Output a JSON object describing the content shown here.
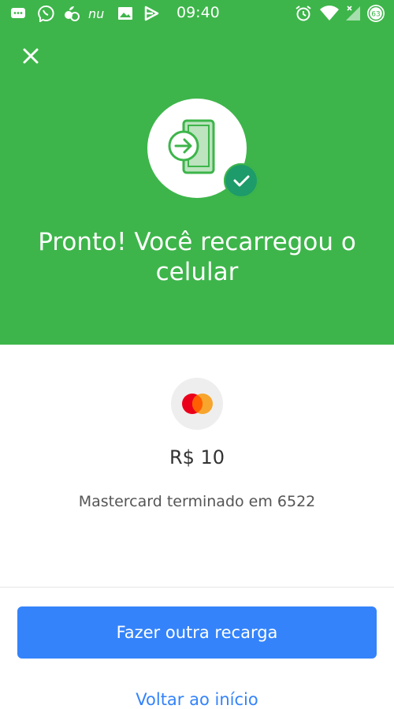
{
  "status_bar": {
    "time": "09:40",
    "notification_icons": [
      "message-icon",
      "viber-icon",
      "ifood-icon",
      "nubank-icon",
      "gallery-icon",
      "play-icon"
    ],
    "system_icons": [
      "alarm-icon",
      "wifi-icon",
      "signal-icon",
      "battery-icon"
    ],
    "battery_level": "63"
  },
  "header": {
    "close_icon": "close-icon",
    "illustration_icon": "phone-recharge-icon",
    "success_icon": "check-icon",
    "title": "Pronto! Você recarregou o celular"
  },
  "summary": {
    "card_brand_icon": "mastercard-icon",
    "amount": "R$ 10",
    "payment_method": "Mastercard terminado em 6522"
  },
  "actions": {
    "primary_label": "Fazer outra recarga",
    "secondary_label": "Voltar ao início"
  },
  "colors": {
    "header_green": "#3db54a",
    "badge_green": "#1d9b6a",
    "primary_blue": "#3483fa"
  }
}
